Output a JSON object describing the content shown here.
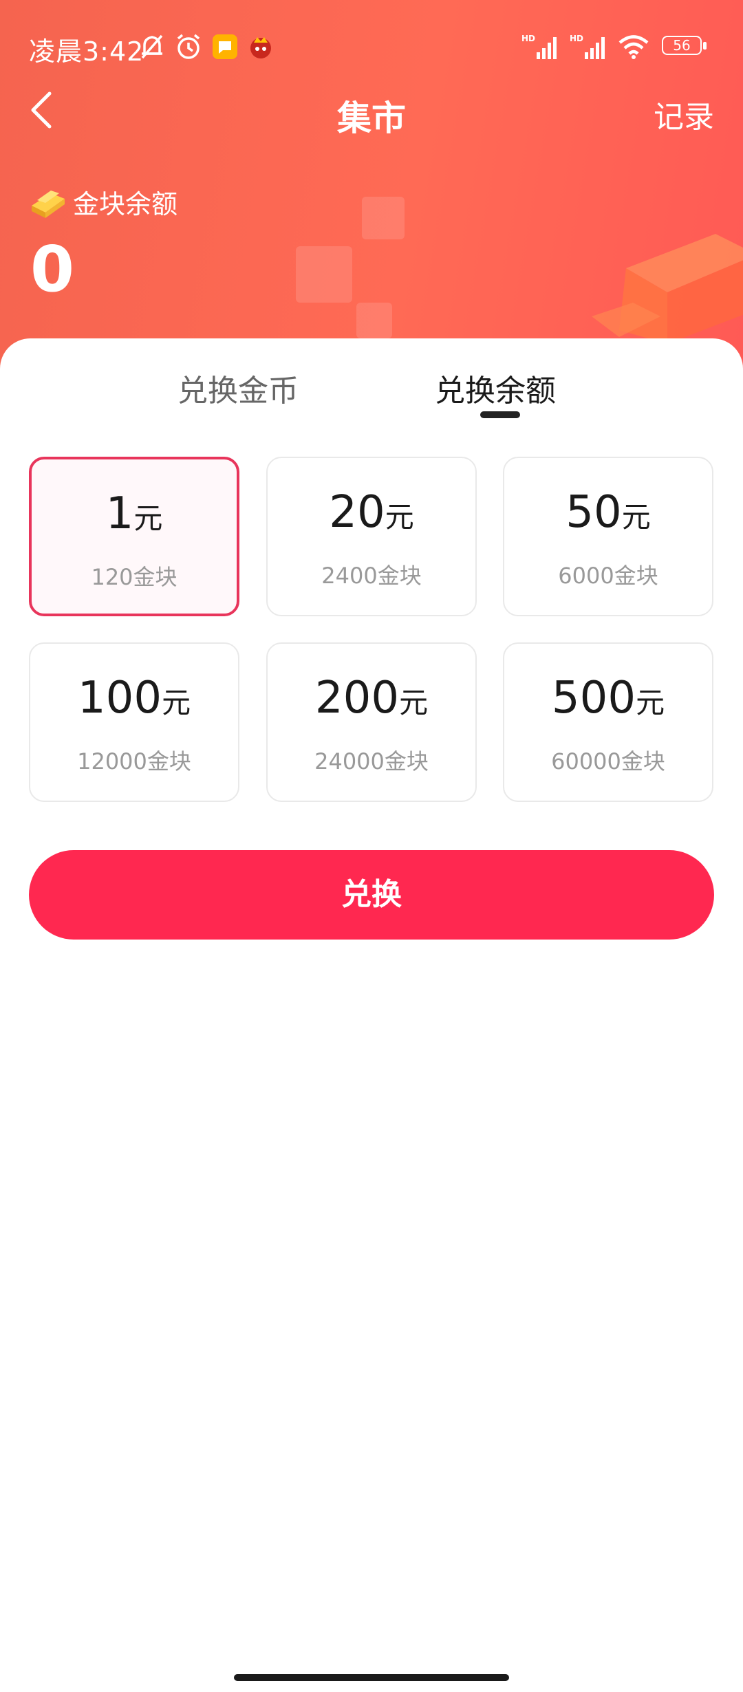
{
  "status_bar": {
    "time": "凌晨3:42",
    "battery": "56",
    "left_icons": [
      "mute-bell-icon",
      "alarm-icon",
      "message-app-icon",
      "app-notification-icon"
    ],
    "right_icons": [
      "hd-signal-icon",
      "hd-signal-icon",
      "wifi-icon",
      "battery-icon"
    ]
  },
  "nav": {
    "title": "集市",
    "record_label": "记录",
    "back_icon": "chevron-left-icon"
  },
  "balance": {
    "label": "金块余额",
    "value": "0",
    "icon": "gold-bar-icon"
  },
  "tabs": [
    {
      "label": "兑换金币",
      "active": false
    },
    {
      "label": "兑换余额",
      "active": true
    }
  ],
  "options": [
    {
      "amount": "1",
      "unit": "元",
      "cost": "120金块",
      "selected": true
    },
    {
      "amount": "20",
      "unit": "元",
      "cost": "2400金块",
      "selected": false
    },
    {
      "amount": "50",
      "unit": "元",
      "cost": "6000金块",
      "selected": false
    },
    {
      "amount": "100",
      "unit": "元",
      "cost": "12000金块",
      "selected": false
    },
    {
      "amount": "200",
      "unit": "元",
      "cost": "24000金块",
      "selected": false
    },
    {
      "amount": "500",
      "unit": "元",
      "cost": "60000金块",
      "selected": false
    }
  ],
  "exchange_button": "兑换",
  "colors": {
    "header": "#ff6a55",
    "accent": "#ff2850",
    "selected_border": "#e8355b"
  }
}
